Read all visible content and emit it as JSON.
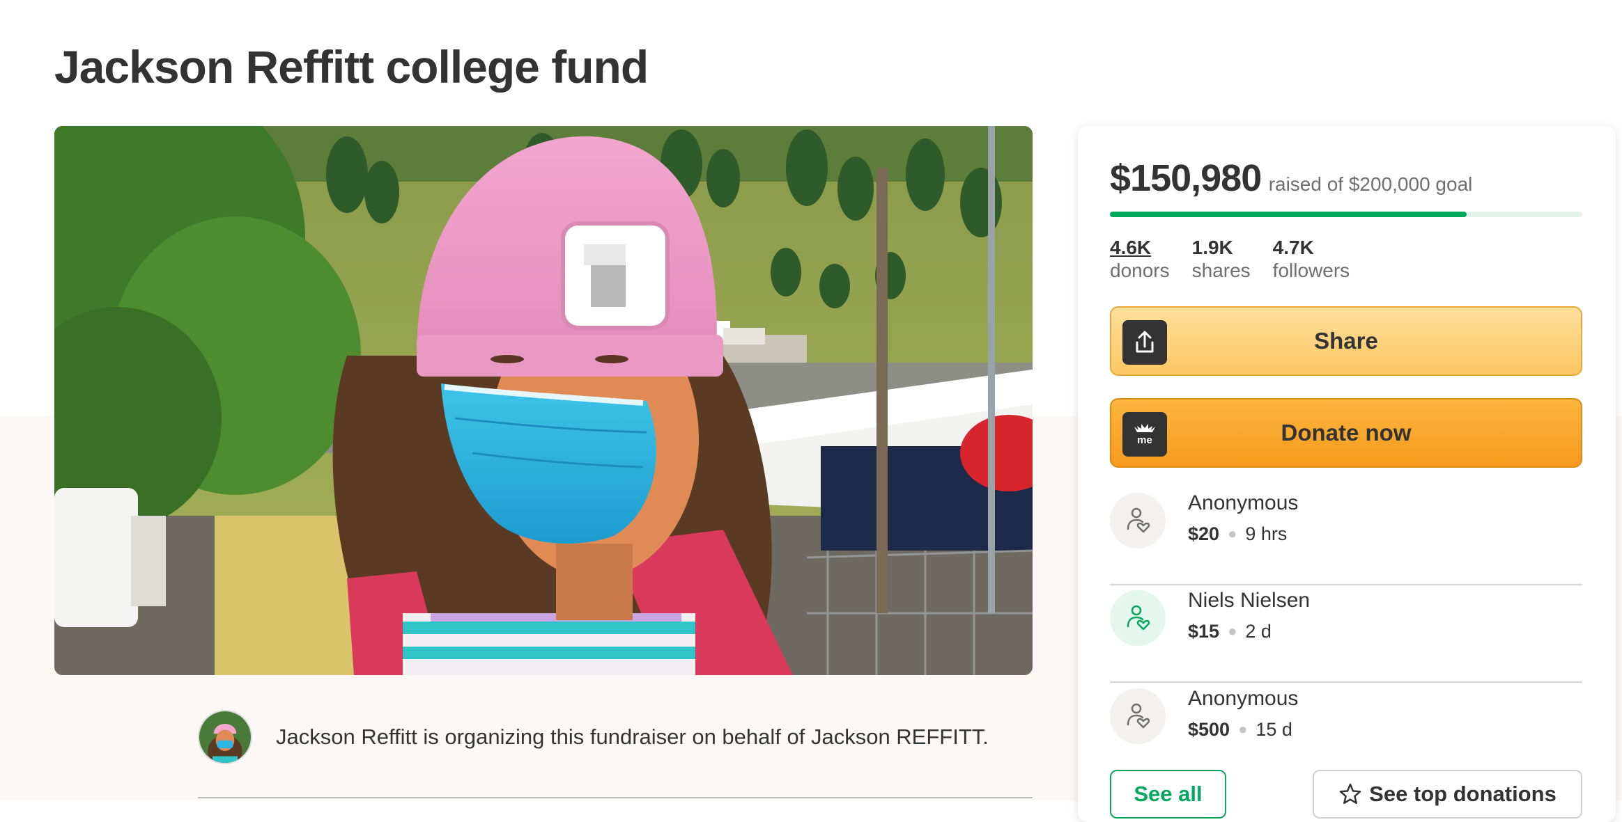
{
  "page": {
    "title": "Jackson Reffitt college fund"
  },
  "organizer": {
    "text": "Jackson Reffitt is organizing this fundraiser on behalf of Jackson REFFITT."
  },
  "campaign": {
    "raised": "$150,980",
    "goal_text": "raised of $200,000 goal",
    "progress_fraction": 0.755,
    "stats": [
      {
        "value": "4.6K",
        "label": "donors"
      },
      {
        "value": "1.9K",
        "label": "shares"
      },
      {
        "value": "4.7K",
        "label": "followers"
      }
    ]
  },
  "buttons": {
    "share": {
      "label": "Share",
      "icon": "share-upload-icon"
    },
    "donate": {
      "label": "Donate now",
      "icon": "gofundme-logo-icon"
    },
    "see_all": "See all",
    "see_top": {
      "label": "See top donations",
      "icon": "star-icon"
    }
  },
  "donations": [
    {
      "name": "Anonymous",
      "amount": "$20",
      "time": "9 hrs",
      "icon": "donor-heart-icon"
    },
    {
      "name": "Niels Nielsen",
      "amount": "$15",
      "time": "2 d",
      "icon": "donor-heart-icon"
    },
    {
      "name": "Anonymous",
      "amount": "$500",
      "time": "15 d",
      "icon": "donor-heart-icon"
    }
  ],
  "colors": {
    "brand_green": "#02a95c",
    "share_button": "#fcc762",
    "donate_button": "#f69a1d",
    "text": "#333333"
  }
}
